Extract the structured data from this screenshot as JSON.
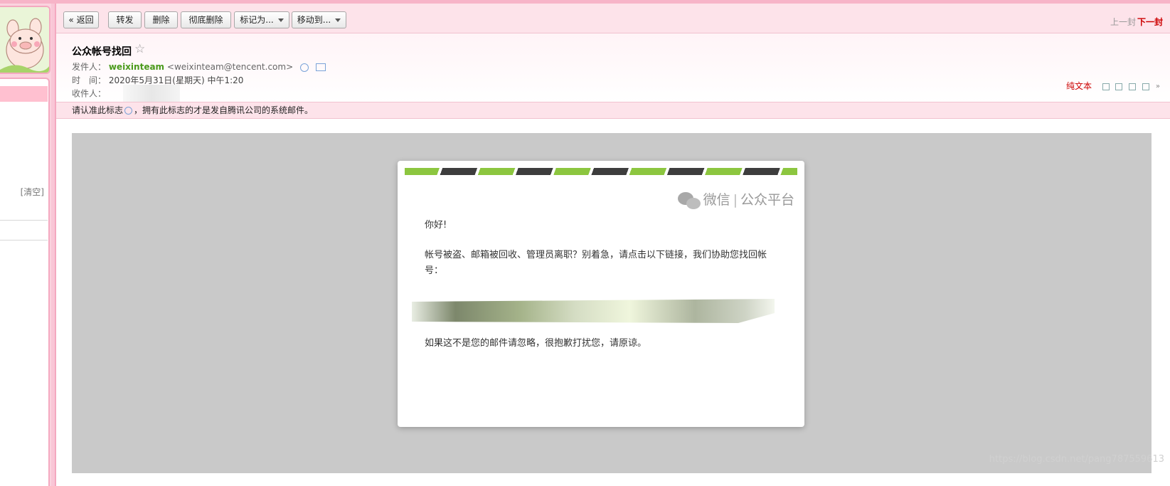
{
  "toolbar": {
    "back": "« 返回",
    "forward": "转发",
    "delete": "删除",
    "delete_permanent": "彻底删除",
    "mark_as": "标记为...",
    "move_to": "移动到...",
    "prev": "上一封",
    "next": "下一封"
  },
  "sidebar": {
    "clear": "[清空]"
  },
  "header": {
    "subject": "公众帐号找回",
    "star": "☆",
    "from_label": "发件人：",
    "from_name": "weixinteam",
    "from_email": "<weixinteam@tencent.com>",
    "time_label": "时　间：",
    "time_value": "2020年5月31日(星期天) 中午1:20",
    "to_label": "收件人：",
    "plain_text": "纯文本"
  },
  "notice": {
    "before": "请认准此标志",
    "after": "，拥有此标志的才是发自腾讯公司的系统邮件。"
  },
  "mail": {
    "logo_brand": "微信",
    "logo_divider": "|",
    "logo_platform": "公众平台",
    "greeting": "你好!",
    "body1": "帐号被盗、邮箱被回收、管理员离职？别着急，请点击以下链接，我们协助您找回帐号：",
    "footer": "如果这不是您的邮件请忽略，很抱歉打扰您，请原谅。"
  },
  "watermark": "https://blog.csdn.net/pang787559613",
  "colors": {
    "accent_pink": "#f4a9c0",
    "sender_green": "#4a9a1b",
    "link_red": "#cc0000",
    "stripe_green": "#8cc63f"
  },
  "icons": [
    "avatar-pig",
    "star-icon",
    "verified-icon",
    "contact-card-icon",
    "view-icons",
    "wechat-logo"
  ]
}
